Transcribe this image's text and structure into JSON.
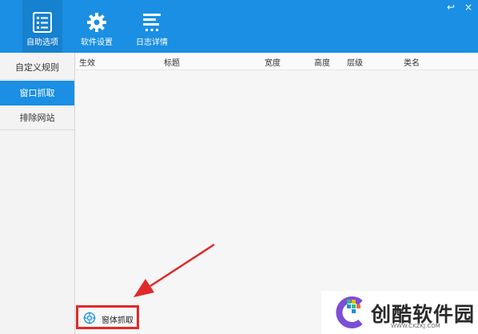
{
  "toolbar": {
    "items": [
      {
        "label": "自助选项",
        "icon": "checklist-icon"
      },
      {
        "label": "软件设置",
        "icon": "gear-icon"
      },
      {
        "label": "日志详情",
        "icon": "log-lines-icon"
      }
    ],
    "window_controls": {
      "back": "↩",
      "close": "×"
    }
  },
  "sidebar": {
    "items": [
      {
        "label": "自定义规则"
      },
      {
        "label": "窗口抓取",
        "selected": true
      },
      {
        "label": "排除网站"
      }
    ]
  },
  "table": {
    "columns": [
      "生效",
      "标题",
      "宽度",
      "高度",
      "层级",
      "类名"
    ]
  },
  "footer": {
    "capture_button": {
      "label": "窗体抓取",
      "icon": "target-icon"
    }
  },
  "watermark": {
    "brand": "创酷软件园",
    "url": "WWW.CKZKJ.COM"
  },
  "colors": {
    "accent": "#1a8fe3",
    "highlight_box": "#e0292a",
    "arrow": "#e0292a"
  }
}
